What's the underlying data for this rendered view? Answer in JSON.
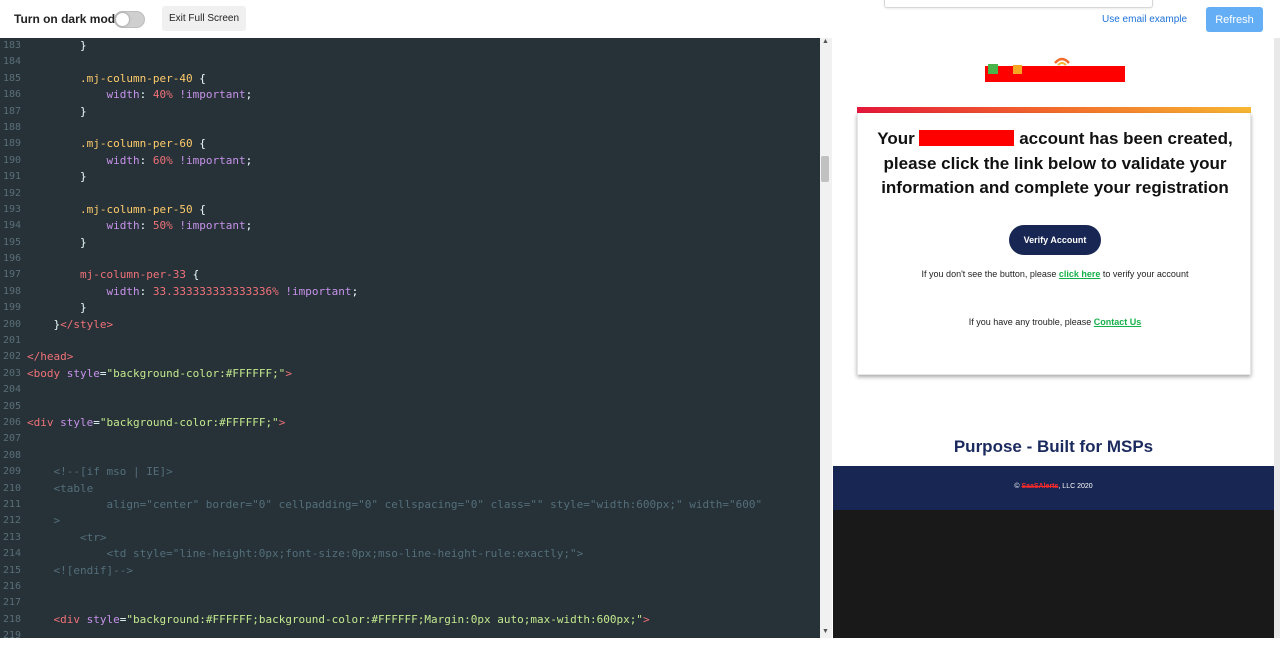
{
  "toolbar": {
    "dark_mode_label": "Turn on dark mode",
    "exit_label": "Exit Full Screen",
    "email_example_label": "Use email example",
    "refresh_label": "Refresh"
  },
  "editor": {
    "lines": [
      {
        "n": "183",
        "parts": [
          {
            "t": "        }",
            "c": "punc"
          }
        ]
      },
      {
        "n": "184",
        "parts": []
      },
      {
        "n": "185",
        "parts": [
          {
            "t": "        ",
            "c": "punc"
          },
          {
            "t": ".mj-column-per-40",
            "c": "cls"
          },
          {
            "t": " {",
            "c": "punc"
          }
        ]
      },
      {
        "n": "186",
        "parts": [
          {
            "t": "            ",
            "c": "punc"
          },
          {
            "t": "width",
            "c": "prop"
          },
          {
            "t": ": ",
            "c": "punc"
          },
          {
            "t": "40%",
            "c": "num"
          },
          {
            "t": " !important",
            "c": "imp"
          },
          {
            "t": ";",
            "c": "punc"
          }
        ]
      },
      {
        "n": "187",
        "parts": [
          {
            "t": "        }",
            "c": "punc"
          }
        ]
      },
      {
        "n": "188",
        "parts": []
      },
      {
        "n": "189",
        "parts": [
          {
            "t": "        ",
            "c": "punc"
          },
          {
            "t": ".mj-column-per-60",
            "c": "cls"
          },
          {
            "t": " {",
            "c": "punc"
          }
        ]
      },
      {
        "n": "190",
        "parts": [
          {
            "t": "            ",
            "c": "punc"
          },
          {
            "t": "width",
            "c": "prop"
          },
          {
            "t": ": ",
            "c": "punc"
          },
          {
            "t": "60%",
            "c": "num"
          },
          {
            "t": " !important",
            "c": "imp"
          },
          {
            "t": ";",
            "c": "punc"
          }
        ]
      },
      {
        "n": "191",
        "parts": [
          {
            "t": "        }",
            "c": "punc"
          }
        ]
      },
      {
        "n": "192",
        "parts": []
      },
      {
        "n": "193",
        "parts": [
          {
            "t": "        ",
            "c": "punc"
          },
          {
            "t": ".mj-column-per-50",
            "c": "cls"
          },
          {
            "t": " {",
            "c": "punc"
          }
        ]
      },
      {
        "n": "194",
        "parts": [
          {
            "t": "            ",
            "c": "punc"
          },
          {
            "t": "width",
            "c": "prop"
          },
          {
            "t": ": ",
            "c": "punc"
          },
          {
            "t": "50%",
            "c": "num"
          },
          {
            "t": " !important",
            "c": "imp"
          },
          {
            "t": ";",
            "c": "punc"
          }
        ]
      },
      {
        "n": "195",
        "parts": [
          {
            "t": "        }",
            "c": "punc"
          }
        ]
      },
      {
        "n": "196",
        "parts": []
      },
      {
        "n": "197",
        "parts": [
          {
            "t": "        ",
            "c": "punc"
          },
          {
            "t": "mj-column-per-33",
            "c": "sel"
          },
          {
            "t": " {",
            "c": "punc"
          }
        ]
      },
      {
        "n": "198",
        "parts": [
          {
            "t": "            ",
            "c": "punc"
          },
          {
            "t": "width",
            "c": "prop"
          },
          {
            "t": ": ",
            "c": "punc"
          },
          {
            "t": "33.333333333333336%",
            "c": "num"
          },
          {
            "t": " !important",
            "c": "imp"
          },
          {
            "t": ";",
            "c": "punc"
          }
        ]
      },
      {
        "n": "199",
        "parts": [
          {
            "t": "        }",
            "c": "punc"
          }
        ]
      },
      {
        "n": "200",
        "parts": [
          {
            "t": "    }",
            "c": "punc"
          },
          {
            "t": "</style>",
            "c": "tag"
          }
        ]
      },
      {
        "n": "201",
        "parts": []
      },
      {
        "n": "202",
        "parts": [
          {
            "t": "</head>",
            "c": "tag"
          }
        ]
      },
      {
        "n": "203",
        "parts": [
          {
            "t": "<body",
            "c": "tag"
          },
          {
            "t": " style",
            "c": "attr"
          },
          {
            "t": "=",
            "c": "punc"
          },
          {
            "t": "\"background-color:#FFFFFF;\"",
            "c": "str"
          },
          {
            "t": ">",
            "c": "tag"
          }
        ]
      },
      {
        "n": "204",
        "parts": []
      },
      {
        "n": "205",
        "parts": []
      },
      {
        "n": "206",
        "parts": [
          {
            "t": "<div",
            "c": "tag"
          },
          {
            "t": " style",
            "c": "attr"
          },
          {
            "t": "=",
            "c": "punc"
          },
          {
            "t": "\"background-color:#FFFFFF;\"",
            "c": "str"
          },
          {
            "t": ">",
            "c": "tag"
          }
        ]
      },
      {
        "n": "207",
        "parts": []
      },
      {
        "n": "208",
        "parts": []
      },
      {
        "n": "209",
        "parts": [
          {
            "t": "    <!--[if mso | IE]>",
            "c": "com"
          }
        ]
      },
      {
        "n": "210",
        "parts": [
          {
            "t": "    <table",
            "c": "com"
          }
        ]
      },
      {
        "n": "211",
        "parts": [
          {
            "t": "            align=\"center\" border=\"0\" cellpadding=\"0\" cellspacing=\"0\" class=\"\" style=\"width:600px;\" width=\"600\"",
            "c": "com"
          }
        ]
      },
      {
        "n": "212",
        "parts": [
          {
            "t": "    >",
            "c": "com"
          }
        ]
      },
      {
        "n": "213",
        "parts": [
          {
            "t": "        <tr>",
            "c": "com"
          }
        ]
      },
      {
        "n": "214",
        "parts": [
          {
            "t": "            <td style=\"line-height:0px;font-size:0px;mso-line-height-rule:exactly;\">",
            "c": "com"
          }
        ]
      },
      {
        "n": "215",
        "parts": [
          {
            "t": "    <![endif]-->",
            "c": "com"
          }
        ]
      },
      {
        "n": "216",
        "parts": []
      },
      {
        "n": "217",
        "parts": []
      },
      {
        "n": "218",
        "parts": [
          {
            "t": "    ",
            "c": "punc"
          },
          {
            "t": "<div",
            "c": "tag"
          },
          {
            "t": " style",
            "c": "attr"
          },
          {
            "t": "=",
            "c": "punc"
          },
          {
            "t": "\"background:#FFFFFF;background-color:#FFFFFF;Margin:0px auto;max-width:600px;\"",
            "c": "str"
          },
          {
            "t": ">",
            "c": "tag"
          }
        ]
      },
      {
        "n": "219",
        "parts": []
      }
    ]
  },
  "preview": {
    "headline_before": "Your",
    "headline_after": "account has been created, please click the link below to validate your information and complete your registration",
    "verify_label": "Verify Account",
    "note1_before": "If you don't see the button, please ",
    "note1_link": "click here",
    "note1_after": " to verify your account",
    "note2_before": "If you have any trouble, please ",
    "note2_link": "Contact Us",
    "purpose": "Purpose - Built for MSPs",
    "copyright_symbol": "© ",
    "copyright_company": "SaaSAlerts",
    "copyright_rest": ", LLC 2020"
  },
  "colors": {
    "editor_bg": "#263238",
    "navy": "#172652",
    "link_green": "#16b04a",
    "refresh_blue": "#64aef5",
    "redaction": "#ff0000"
  }
}
